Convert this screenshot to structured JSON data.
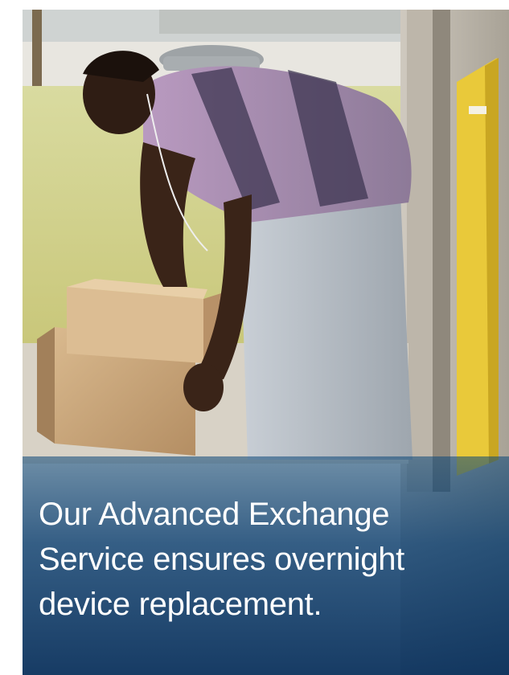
{
  "hero": {
    "caption": "Our Advanced Exchange Service ensures overnight device replacement.",
    "caption_color": "#ffffff",
    "overlay_color": "#0a4a80"
  }
}
